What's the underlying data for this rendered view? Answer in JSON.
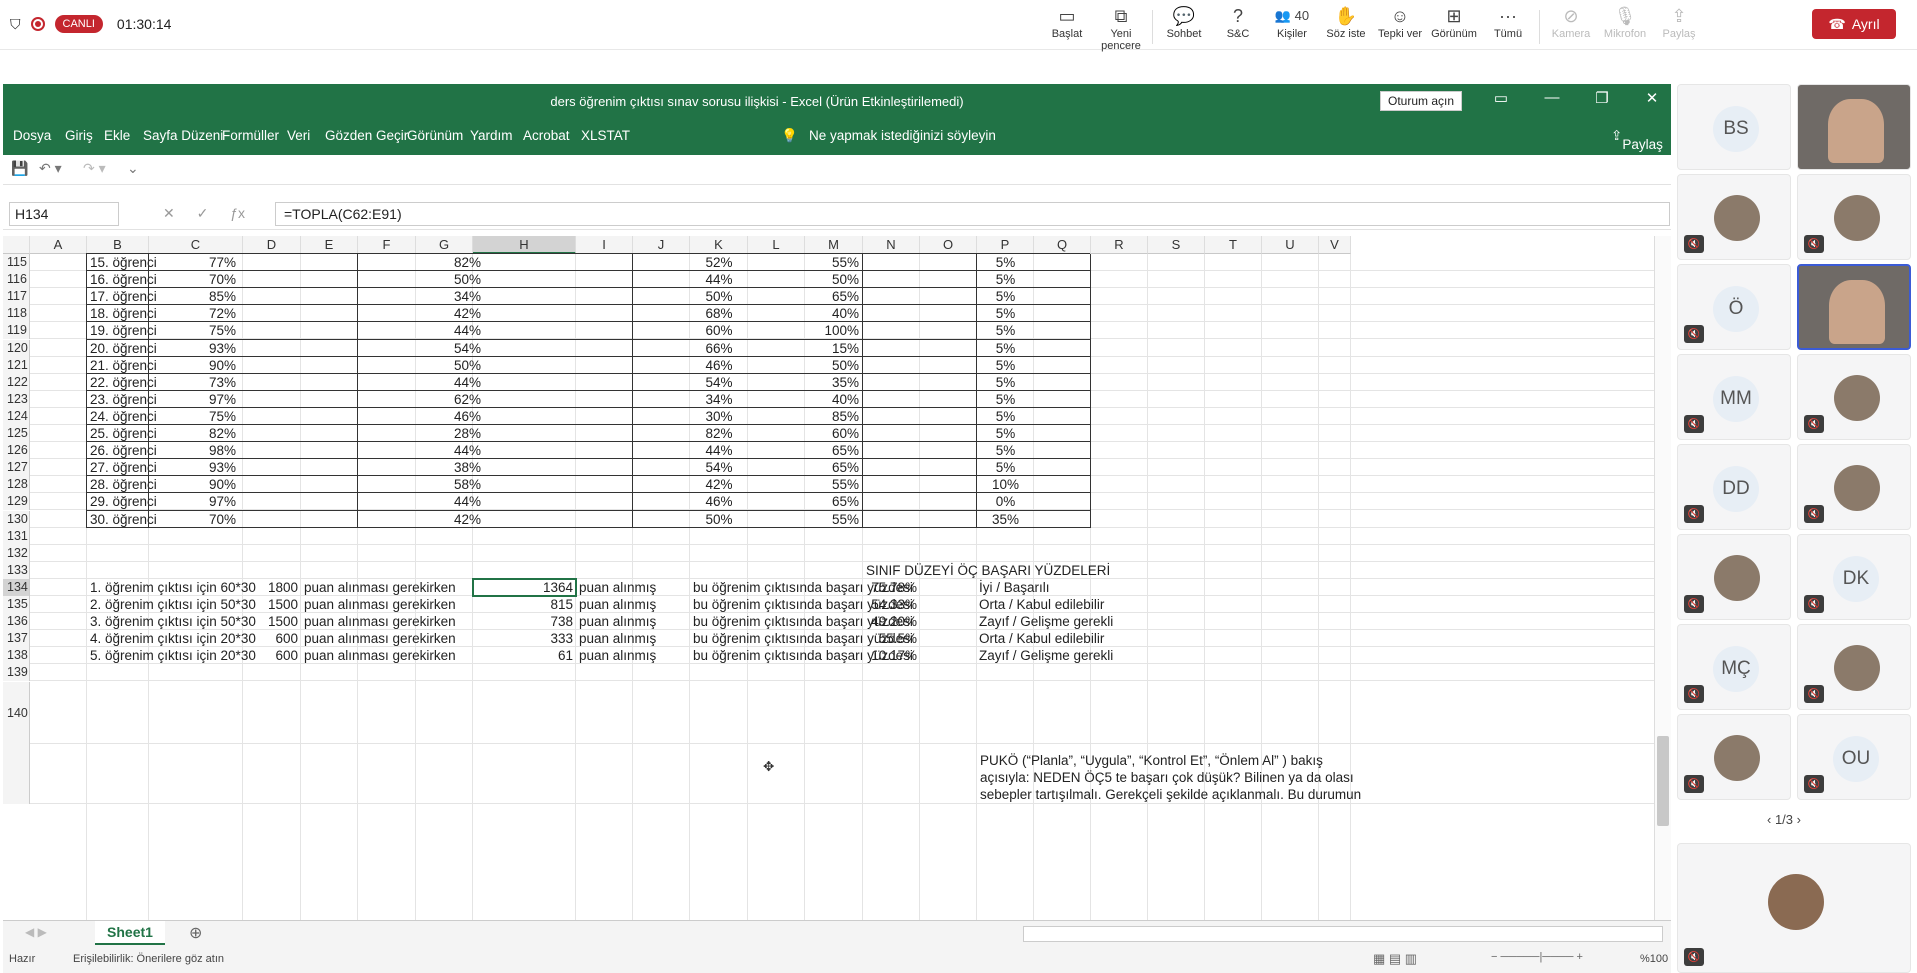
{
  "meeting": {
    "live_label": "CANLI",
    "timer": "01:30:14",
    "leave_label": "Ayrıl",
    "tools": [
      {
        "label": "Başlat",
        "icon": "▭"
      },
      {
        "label": "Yeni pencere",
        "icon": "⧉"
      },
      {
        "label": "Sohbet",
        "icon": "💬"
      },
      {
        "label": "S&C",
        "icon": "?"
      },
      {
        "label": "Kişiler",
        "icon": "👥",
        "badge": "40"
      },
      {
        "label": "Söz iste",
        "icon": "✋"
      },
      {
        "label": "Tepki ver",
        "icon": "☺"
      },
      {
        "label": "Görünüm",
        "icon": "⊞"
      },
      {
        "label": "Tümü",
        "icon": "···"
      },
      {
        "label": "Kamera",
        "icon": "⊘"
      },
      {
        "label": "Mikrofon",
        "icon": "🎙"
      },
      {
        "label": "Paylaş",
        "icon": "⇪"
      }
    ]
  },
  "excel": {
    "title": "ders öğrenim çıktısı sınav sorusu ilişkisi  -  Excel (Ürün Etkinleştirilemedi)",
    "signin": "Oturum açın",
    "menu": [
      "Dosya",
      "Giriş",
      "Ekle",
      "Sayfa Düzeni",
      "Formüller",
      "Veri",
      "Gözden Geçir",
      "Görünüm",
      "Yardım",
      "Acrobat",
      "XLSTAT"
    ],
    "tell_me": "Ne yapmak istediğinizi söyleyin",
    "share": "Paylaş",
    "name_box": "H134",
    "formula": "=TOPLA(C62:E91)",
    "columns": [
      "A",
      "B",
      "C",
      "D",
      "E",
      "F",
      "G",
      "H",
      "I",
      "J",
      "K",
      "L",
      "M",
      "N",
      "O",
      "P",
      "Q",
      "R",
      "S",
      "T",
      "U",
      "V"
    ],
    "student_rows": [
      {
        "row": "115",
        "name": "15. öğrenci",
        "c": "77%",
        "h": "82%",
        "k": "52%",
        "n": "55%",
        "p": "5%"
      },
      {
        "row": "116",
        "name": "16. öğrenci",
        "c": "70%",
        "h": "50%",
        "k": "44%",
        "n": "50%",
        "p": "5%"
      },
      {
        "row": "117",
        "name": "17. öğrenci",
        "c": "85%",
        "h": "34%",
        "k": "50%",
        "n": "65%",
        "p": "5%"
      },
      {
        "row": "118",
        "name": "18. öğrenci",
        "c": "72%",
        "h": "42%",
        "k": "68%",
        "n": "40%",
        "p": "5%"
      },
      {
        "row": "119",
        "name": "19. öğrenci",
        "c": "75%",
        "h": "44%",
        "k": "60%",
        "n": "100%",
        "p": "5%"
      },
      {
        "row": "120",
        "name": "20. öğrenci",
        "c": "93%",
        "h": "54%",
        "k": "66%",
        "n": "15%",
        "p": "5%"
      },
      {
        "row": "121",
        "name": "21. öğrenci",
        "c": "90%",
        "h": "50%",
        "k": "46%",
        "n": "50%",
        "p": "5%"
      },
      {
        "row": "122",
        "name": "22. öğrenci",
        "c": "73%",
        "h": "44%",
        "k": "54%",
        "n": "35%",
        "p": "5%"
      },
      {
        "row": "123",
        "name": "23. öğrenci",
        "c": "97%",
        "h": "62%",
        "k": "34%",
        "n": "40%",
        "p": "5%"
      },
      {
        "row": "124",
        "name": "24. öğrenci",
        "c": "75%",
        "h": "46%",
        "k": "30%",
        "n": "85%",
        "p": "5%"
      },
      {
        "row": "125",
        "name": "25. öğrenci",
        "c": "82%",
        "h": "28%",
        "k": "82%",
        "n": "60%",
        "p": "5%"
      },
      {
        "row": "126",
        "name": "26. öğrenci",
        "c": "98%",
        "h": "44%",
        "k": "44%",
        "n": "65%",
        "p": "5%"
      },
      {
        "row": "127",
        "name": "27. öğrenci",
        "c": "93%",
        "h": "38%",
        "k": "54%",
        "n": "65%",
        "p": "5%"
      },
      {
        "row": "128",
        "name": "28. öğrenci",
        "c": "90%",
        "h": "58%",
        "k": "42%",
        "n": "55%",
        "p": "10%"
      },
      {
        "row": "129",
        "name": "29. öğrenci",
        "c": "97%",
        "h": "44%",
        "k": "46%",
        "n": "65%",
        "p": "0%"
      },
      {
        "row": "130",
        "name": "30. öğrenci",
        "c": "70%",
        "h": "42%",
        "k": "50%",
        "n": "55%",
        "p": "35%"
      }
    ],
    "empty_rows": [
      "131",
      "132"
    ],
    "header_row": "133",
    "summary_header": "SINIF DÜZEYİ ÖÇ BAŞARI YÜZDELERİ",
    "summary_rows": [
      {
        "row": "134",
        "label": "1. öğrenim çıktısı için 60*30",
        "req": "1800",
        "req_text": "puan alınması gerekirken",
        "got": "1364",
        "got_text": "puan alınmış",
        "rate_text": "bu öğrenim çıktısında başarı yüzdesi",
        "pct": "75.78%",
        "level": "İyi / Başarılı"
      },
      {
        "row": "135",
        "label": "2. öğrenim çıktısı için 50*30",
        "req": "1500",
        "req_text": "puan alınması gerekirken",
        "got": "815",
        "got_text": "puan alınmış",
        "rate_text": "bu öğrenim çıktısında başarı yüzdesi",
        "pct": "54.33%",
        "level": "Orta / Kabul edilebilir"
      },
      {
        "row": "136",
        "label": "3. öğrenim çıktısı için 50*30",
        "req": "1500",
        "req_text": "puan alınması gerekirken",
        "got": "738",
        "got_text": "puan alınmış",
        "rate_text": "bu öğrenim çıktısında başarı yüzdesi",
        "pct": "49.20%",
        "level": "Zayıf / Gelişme gerekli"
      },
      {
        "row": "137",
        "label": "4. öğrenim çıktısı için 20*30",
        "req": "600",
        "req_text": "puan alınması gerekirken",
        "got": "333",
        "got_text": "puan alınmış",
        "rate_text": "bu öğrenim çıktısında başarı yüzdesi",
        "pct": "55.5%",
        "level": "Orta / Kabul edilebilir"
      },
      {
        "row": "138",
        "label": "5. öğrenim çıktısı için 20*30",
        "req": "600",
        "req_text": "puan alınması gerekirken",
        "got": "61",
        "got_text": "puan alınmış",
        "rate_text": "bu öğrenim çıktısında başarı yüzdesi",
        "pct": "10.17%",
        "level": "Zayıf / Gelişme gerekli"
      }
    ],
    "row139": "139",
    "row140": "140",
    "note_lines": [
      "PUKÖ (“Planla”, “Uygula”, “Kontrol Et”, “Önlem Al” ) bakış",
      "açısıyla: NEDEN ÖÇ5 te başarı çok düşük? Bilinen ya da olası",
      "sebepler tartışılmalı. Gerekçeli şekilde açıklanmalı. Bu durumun"
    ],
    "sheet_tab": "Sheet1",
    "status_ready": "Hazır",
    "status_access": "Erişilebilirlik: Önerilere göz atın",
    "zoom": "%100"
  },
  "participants": {
    "page": "1/3",
    "tiles": [
      {
        "initials": "BS",
        "video": false,
        "muted": false
      },
      {
        "initials": "",
        "video": true,
        "muted": false
      },
      {
        "initials": "",
        "video": false,
        "muted": true,
        "photo": true
      },
      {
        "initials": "",
        "video": false,
        "muted": true,
        "photo": true
      },
      {
        "initials": "Ö",
        "video": false,
        "muted": true
      },
      {
        "initials": "",
        "video": true,
        "muted": false,
        "active": true
      },
      {
        "initials": "MM",
        "video": false,
        "muted": true
      },
      {
        "initials": "",
        "video": false,
        "muted": true,
        "photo": true
      },
      {
        "initials": "DD",
        "video": false,
        "muted": true
      },
      {
        "initials": "",
        "video": false,
        "muted": true,
        "photo": true
      },
      {
        "initials": "",
        "video": false,
        "muted": true,
        "photo": true
      },
      {
        "initials": "DK",
        "video": false,
        "muted": true
      },
      {
        "initials": "MÇ",
        "video": false,
        "muted": true
      },
      {
        "initials": "",
        "video": false,
        "muted": true,
        "photo": true
      },
      {
        "initials": "",
        "video": false,
        "muted": true,
        "photo": true
      },
      {
        "initials": "OU",
        "video": false,
        "muted": true
      }
    ],
    "bottom_tile_muted": true
  },
  "colors": {
    "excel_green": "#217346",
    "live_red": "#c4262e",
    "active_tile": "#3b5bd6"
  }
}
